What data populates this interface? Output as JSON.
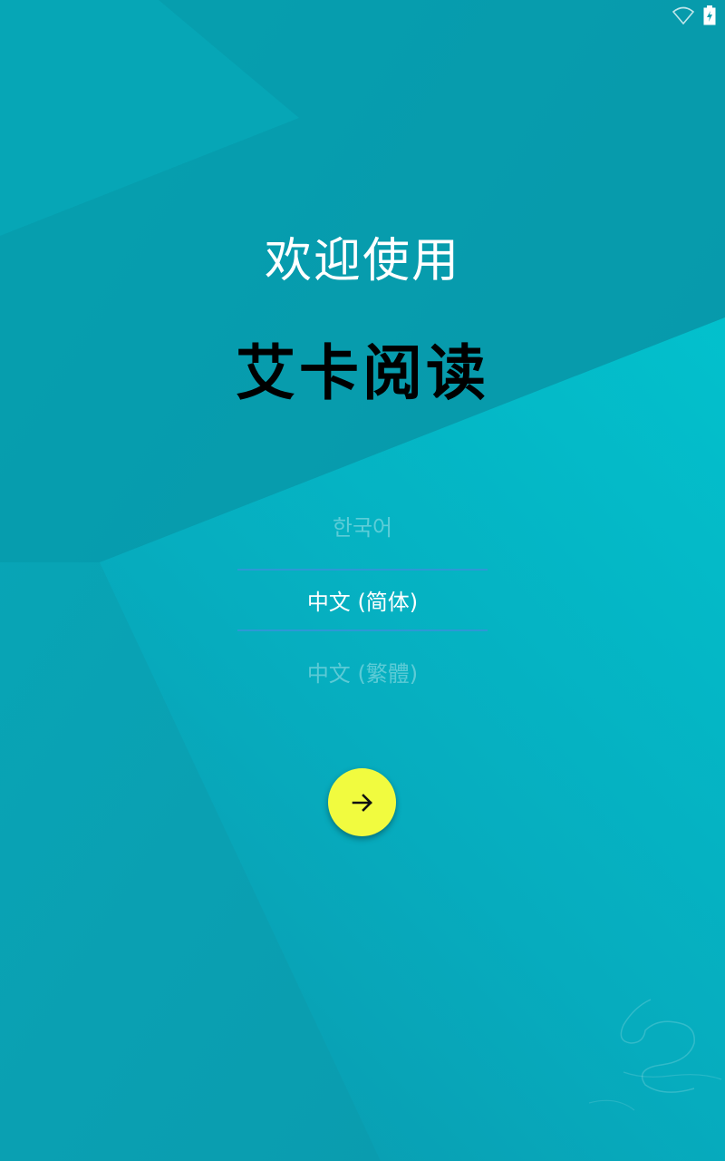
{
  "colors": {
    "background_primary": "#0a9fb0",
    "background_dark": "#0491a2",
    "background_light": "#00c8d2",
    "accent_button": "#f1fb3f",
    "divider": "#2d98d6"
  },
  "status_bar": {
    "icons": [
      "wifi-icon",
      "battery-charging-icon"
    ]
  },
  "welcome": {
    "title": "欢迎使用",
    "app_name": "艾卡阅读"
  },
  "language_picker": {
    "options": [
      "한국어",
      "中文 (简体)",
      "中文 (繁體)"
    ],
    "selected": "中文 (简体)"
  },
  "next_button": {
    "icon": "arrow-right-icon"
  }
}
